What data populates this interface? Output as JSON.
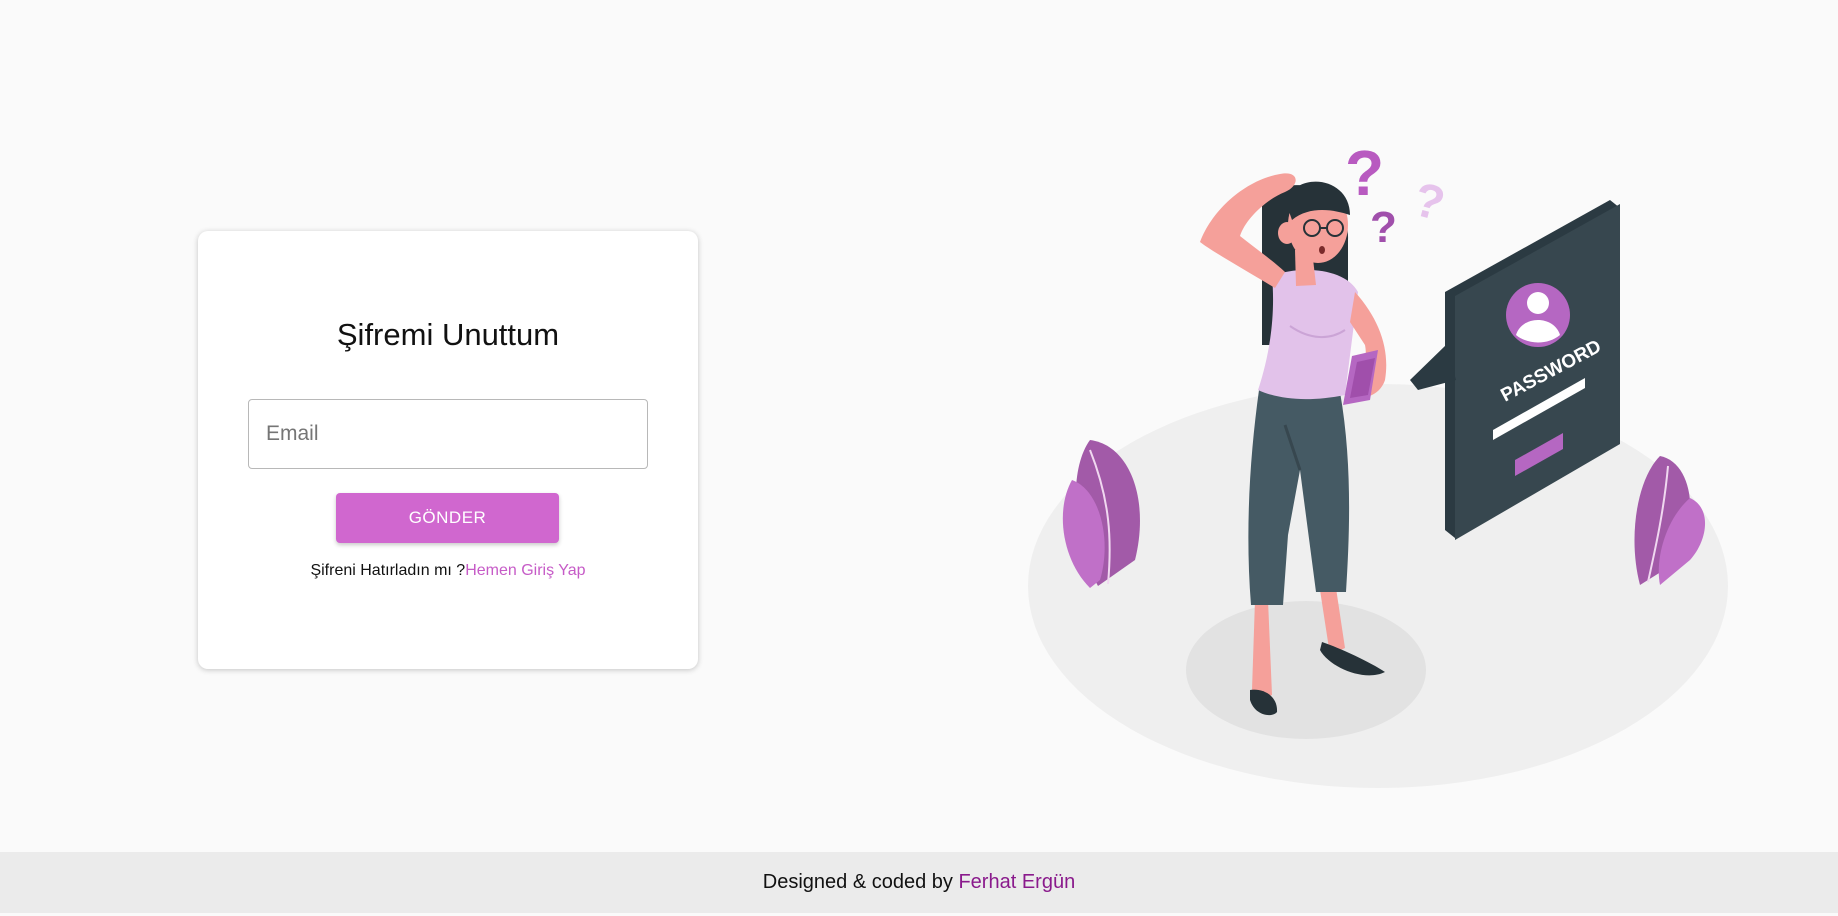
{
  "form": {
    "title": "Şifremi Unuttum",
    "email_placeholder": "Email",
    "email_value": "",
    "submit_label": "GÖNDER",
    "remember_text": "Şifreni Hatırladın mı ?",
    "login_link_label": "Hemen Giriş Yap"
  },
  "illustration": {
    "screen_text": "PASSWORD",
    "question_marks": [
      "?",
      "?",
      "?"
    ]
  },
  "footer": {
    "credit_text": "Designed & coded by ",
    "author_name": "Ferhat Ergün"
  },
  "colors": {
    "accent": "#d067cf",
    "link": "#c65bc7",
    "author_link": "#8a1a8c",
    "background": "#fafafa",
    "footer_bg": "#ebebeb"
  }
}
